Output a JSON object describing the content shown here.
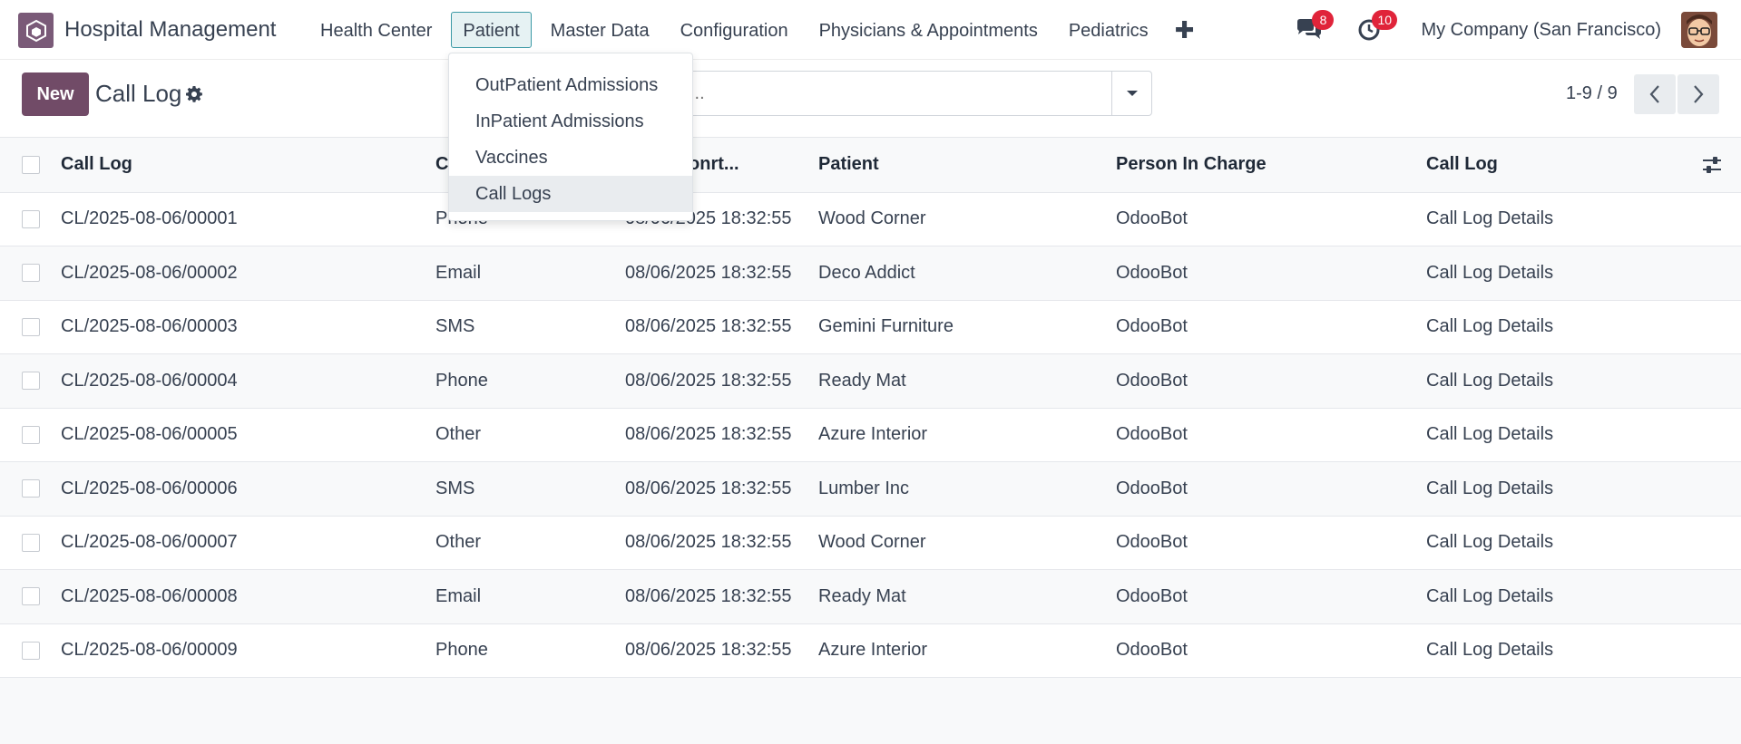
{
  "app": {
    "title": "Hospital Management"
  },
  "nav": {
    "items": [
      "Health Center",
      "Patient",
      "Master Data",
      "Configuration",
      "Physicians & Appointments",
      "Pediatrics"
    ],
    "active": "Patient",
    "plus": "✚"
  },
  "systray": {
    "messages_count": "8",
    "activities_count": "10",
    "company": "My Company (San Francisco)"
  },
  "control": {
    "new_label": "New",
    "title": "Call Log",
    "search_placeholder": "...",
    "pager": "1-9 / 9"
  },
  "dropdown": {
    "items": [
      "OutPatient Admissions",
      "InPatient Admissions",
      "Vaccines",
      "Call Logs"
    ],
    "active": "Call Logs"
  },
  "table": {
    "headers": [
      "Call Log",
      "C",
      "me of conrt...",
      "Patient",
      "Person In Charge",
      "Call Log"
    ],
    "rows": [
      [
        "CL/2025-08-06/00001",
        "Phone",
        "08/06/2025 18:32:55",
        "Wood Corner",
        "OdooBot",
        "Call Log Details"
      ],
      [
        "CL/2025-08-06/00002",
        "Email",
        "08/06/2025 18:32:55",
        "Deco Addict",
        "OdooBot",
        "Call Log Details"
      ],
      [
        "CL/2025-08-06/00003",
        "SMS",
        "08/06/2025 18:32:55",
        "Gemini Furniture",
        "OdooBot",
        "Call Log Details"
      ],
      [
        "CL/2025-08-06/00004",
        "Phone",
        "08/06/2025 18:32:55",
        "Ready Mat",
        "OdooBot",
        "Call Log Details"
      ],
      [
        "CL/2025-08-06/00005",
        "Other",
        "08/06/2025 18:32:55",
        "Azure Interior",
        "OdooBot",
        "Call Log Details"
      ],
      [
        "CL/2025-08-06/00006",
        "SMS",
        "08/06/2025 18:32:55",
        "Lumber Inc",
        "OdooBot",
        "Call Log Details"
      ],
      [
        "CL/2025-08-06/00007",
        "Other",
        "08/06/2025 18:32:55",
        "Wood Corner",
        "OdooBot",
        "Call Log Details"
      ],
      [
        "CL/2025-08-06/00008",
        "Email",
        "08/06/2025 18:32:55",
        "Ready Mat",
        "OdooBot",
        "Call Log Details"
      ],
      [
        "CL/2025-08-06/00009",
        "Phone",
        "08/06/2025 18:32:55",
        "Azure Interior",
        "OdooBot",
        "Call Log Details"
      ]
    ]
  },
  "colors": {
    "brand": "#714b67",
    "badge": "#e0243a",
    "active_nav_border": "#3c9aa6"
  }
}
